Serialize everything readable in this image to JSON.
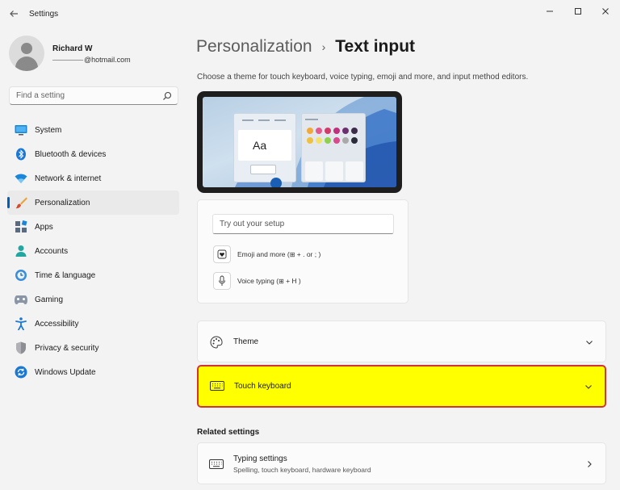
{
  "app": {
    "title": "Settings",
    "back_icon": "back-arrow-icon",
    "window_controls": [
      "minimize-icon",
      "maximize-icon",
      "close-icon"
    ]
  },
  "account": {
    "name": "Richard W",
    "email": "@hotmail.com"
  },
  "search": {
    "placeholder": "Find a setting",
    "icon": "search-icon"
  },
  "nav": {
    "items": [
      {
        "label": "System",
        "icon": "monitor-icon",
        "active": false
      },
      {
        "label": "Bluetooth & devices",
        "icon": "bluetooth-icon",
        "active": false
      },
      {
        "label": "Network & internet",
        "icon": "wifi-icon",
        "active": false
      },
      {
        "label": "Personalization",
        "icon": "paintbrush-icon",
        "active": true
      },
      {
        "label": "Apps",
        "icon": "apps-icon",
        "active": false
      },
      {
        "label": "Accounts",
        "icon": "person-icon",
        "active": false
      },
      {
        "label": "Time & language",
        "icon": "globe-clock-icon",
        "active": false
      },
      {
        "label": "Gaming",
        "icon": "gamepad-icon",
        "active": false
      },
      {
        "label": "Accessibility",
        "icon": "accessibility-icon",
        "active": false
      },
      {
        "label": "Privacy & security",
        "icon": "shield-icon",
        "active": false
      },
      {
        "label": "Windows Update",
        "icon": "update-icon",
        "active": false
      }
    ]
  },
  "main": {
    "breadcrumb_parent": "Personalization",
    "breadcrumb_separator": "›",
    "breadcrumb_current": "Text input",
    "description": "Choose a theme for touch keyboard, voice typing, emoji and more, and input method editors.",
    "preview": {
      "sample_text": "Aa",
      "swatches": [
        "#f2a93b",
        "#e05a8c",
        "#d23a6a",
        "#c0307c",
        "#6c2f6e",
        "#3d2b4a",
        "#f0c040",
        "#f3e26a",
        "#8fd14f",
        "#d84a8c",
        "#a9a9a9",
        "#2b2b3a"
      ]
    },
    "tryout": {
      "placeholder": "Try out your setup",
      "emoji_label_pre": "Emoji and more (",
      "emoji_label_post": " + . or ; )",
      "voice_label_pre": "Voice typing (",
      "voice_label_post": " + H )",
      "win_key_glyph": "⊞"
    },
    "cards": {
      "theme": {
        "title": "Theme",
        "icon": "palette-icon"
      },
      "touch_keyboard": {
        "title": "Touch keyboard",
        "icon": "keyboard-icon",
        "highlighted": true
      }
    },
    "related_settings": {
      "heading": "Related settings",
      "typing": {
        "title": "Typing settings",
        "subtitle": "Spelling, touch keyboard, hardware keyboard",
        "icon": "keyboard-icon"
      }
    }
  },
  "colors": {
    "accent": "#005fb8",
    "highlight": "#ffff00",
    "highlight_border": "#d13438"
  }
}
